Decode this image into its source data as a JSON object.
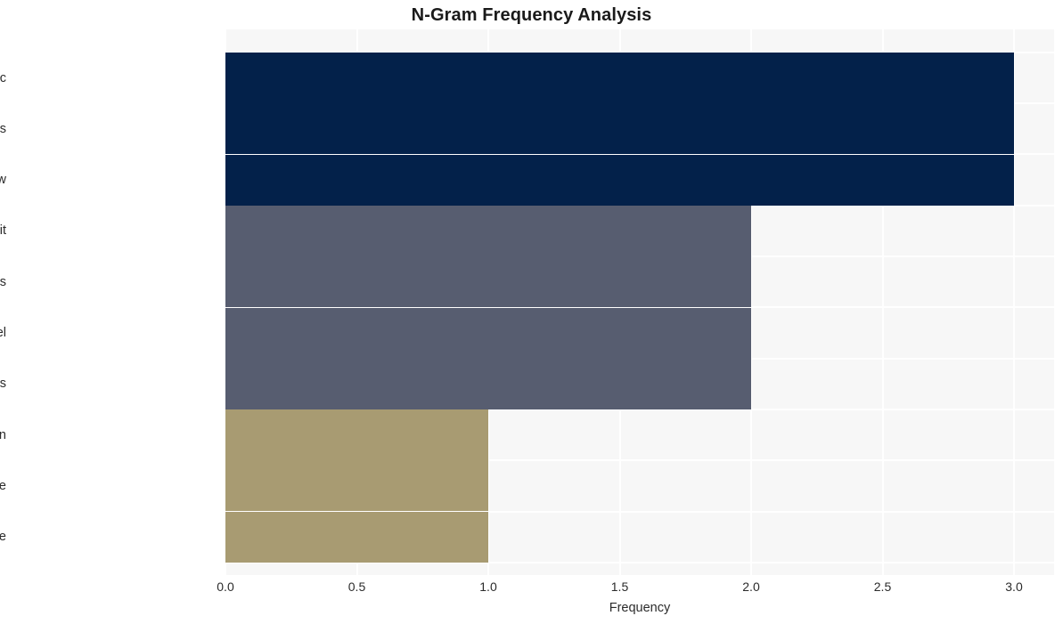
{
  "chart_data": {
    "type": "bar",
    "orientation": "horizontal",
    "title": "N-Gram Frequency Analysis",
    "xlabel": "Frequency",
    "ylabel": "",
    "categories": [
      "linux admins infosec",
      "admins infosec professionals",
      "linux kernel flaw",
      "proof concept exploit",
      "long term consequences",
      "bug linux kernel",
      "infosec professionals sysadmins",
      "hash world open",
      "world open source",
      "open source software"
    ],
    "values": [
      3,
      3,
      3,
      2,
      2,
      2,
      2,
      1,
      1,
      1
    ],
    "bar_colors": [
      "#03214a",
      "#03214a",
      "#03214a",
      "#575d70",
      "#575d70",
      "#575d70",
      "#575d70",
      "#a89b72",
      "#a89b72",
      "#a89b72"
    ],
    "xlim": [
      0.0,
      3.0
    ],
    "xticks": [
      0.0,
      0.5,
      1.0,
      1.5,
      2.0,
      2.5,
      3.0
    ],
    "xtick_labels": [
      "0.0",
      "0.5",
      "1.0",
      "1.5",
      "2.0",
      "2.5",
      "3.0"
    ],
    "grid": true,
    "grid_color": "#ffffff",
    "plot_background": "#f7f7f7",
    "figure_background": "#ffffff",
    "legend": null
  }
}
